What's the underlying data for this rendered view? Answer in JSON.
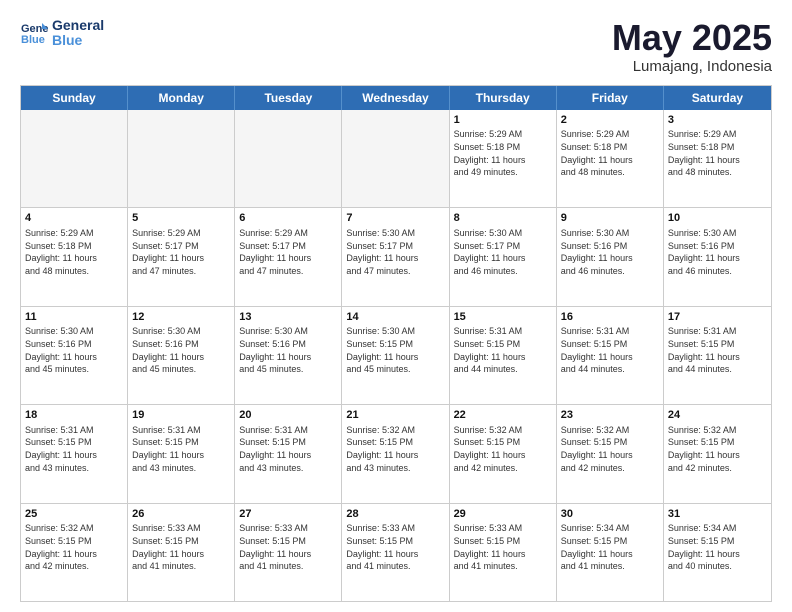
{
  "header": {
    "logo_line1": "General",
    "logo_line2": "Blue",
    "month": "May 2025",
    "location": "Lumajang, Indonesia"
  },
  "days_of_week": [
    "Sunday",
    "Monday",
    "Tuesday",
    "Wednesday",
    "Thursday",
    "Friday",
    "Saturday"
  ],
  "weeks": [
    [
      {
        "day": "",
        "text": "",
        "empty": true
      },
      {
        "day": "",
        "text": "",
        "empty": true
      },
      {
        "day": "",
        "text": "",
        "empty": true
      },
      {
        "day": "",
        "text": "",
        "empty": true
      },
      {
        "day": "1",
        "text": "Sunrise: 5:29 AM\nSunset: 5:18 PM\nDaylight: 11 hours\nand 49 minutes."
      },
      {
        "day": "2",
        "text": "Sunrise: 5:29 AM\nSunset: 5:18 PM\nDaylight: 11 hours\nand 48 minutes."
      },
      {
        "day": "3",
        "text": "Sunrise: 5:29 AM\nSunset: 5:18 PM\nDaylight: 11 hours\nand 48 minutes."
      }
    ],
    [
      {
        "day": "4",
        "text": "Sunrise: 5:29 AM\nSunset: 5:18 PM\nDaylight: 11 hours\nand 48 minutes."
      },
      {
        "day": "5",
        "text": "Sunrise: 5:29 AM\nSunset: 5:17 PM\nDaylight: 11 hours\nand 47 minutes."
      },
      {
        "day": "6",
        "text": "Sunrise: 5:29 AM\nSunset: 5:17 PM\nDaylight: 11 hours\nand 47 minutes."
      },
      {
        "day": "7",
        "text": "Sunrise: 5:30 AM\nSunset: 5:17 PM\nDaylight: 11 hours\nand 47 minutes."
      },
      {
        "day": "8",
        "text": "Sunrise: 5:30 AM\nSunset: 5:17 PM\nDaylight: 11 hours\nand 46 minutes."
      },
      {
        "day": "9",
        "text": "Sunrise: 5:30 AM\nSunset: 5:16 PM\nDaylight: 11 hours\nand 46 minutes."
      },
      {
        "day": "10",
        "text": "Sunrise: 5:30 AM\nSunset: 5:16 PM\nDaylight: 11 hours\nand 46 minutes."
      }
    ],
    [
      {
        "day": "11",
        "text": "Sunrise: 5:30 AM\nSunset: 5:16 PM\nDaylight: 11 hours\nand 45 minutes."
      },
      {
        "day": "12",
        "text": "Sunrise: 5:30 AM\nSunset: 5:16 PM\nDaylight: 11 hours\nand 45 minutes."
      },
      {
        "day": "13",
        "text": "Sunrise: 5:30 AM\nSunset: 5:16 PM\nDaylight: 11 hours\nand 45 minutes."
      },
      {
        "day": "14",
        "text": "Sunrise: 5:30 AM\nSunset: 5:15 PM\nDaylight: 11 hours\nand 45 minutes."
      },
      {
        "day": "15",
        "text": "Sunrise: 5:31 AM\nSunset: 5:15 PM\nDaylight: 11 hours\nand 44 minutes."
      },
      {
        "day": "16",
        "text": "Sunrise: 5:31 AM\nSunset: 5:15 PM\nDaylight: 11 hours\nand 44 minutes."
      },
      {
        "day": "17",
        "text": "Sunrise: 5:31 AM\nSunset: 5:15 PM\nDaylight: 11 hours\nand 44 minutes."
      }
    ],
    [
      {
        "day": "18",
        "text": "Sunrise: 5:31 AM\nSunset: 5:15 PM\nDaylight: 11 hours\nand 43 minutes."
      },
      {
        "day": "19",
        "text": "Sunrise: 5:31 AM\nSunset: 5:15 PM\nDaylight: 11 hours\nand 43 minutes."
      },
      {
        "day": "20",
        "text": "Sunrise: 5:31 AM\nSunset: 5:15 PM\nDaylight: 11 hours\nand 43 minutes."
      },
      {
        "day": "21",
        "text": "Sunrise: 5:32 AM\nSunset: 5:15 PM\nDaylight: 11 hours\nand 43 minutes."
      },
      {
        "day": "22",
        "text": "Sunrise: 5:32 AM\nSunset: 5:15 PM\nDaylight: 11 hours\nand 42 minutes."
      },
      {
        "day": "23",
        "text": "Sunrise: 5:32 AM\nSunset: 5:15 PM\nDaylight: 11 hours\nand 42 minutes."
      },
      {
        "day": "24",
        "text": "Sunrise: 5:32 AM\nSunset: 5:15 PM\nDaylight: 11 hours\nand 42 minutes."
      }
    ],
    [
      {
        "day": "25",
        "text": "Sunrise: 5:32 AM\nSunset: 5:15 PM\nDaylight: 11 hours\nand 42 minutes."
      },
      {
        "day": "26",
        "text": "Sunrise: 5:33 AM\nSunset: 5:15 PM\nDaylight: 11 hours\nand 41 minutes."
      },
      {
        "day": "27",
        "text": "Sunrise: 5:33 AM\nSunset: 5:15 PM\nDaylight: 11 hours\nand 41 minutes."
      },
      {
        "day": "28",
        "text": "Sunrise: 5:33 AM\nSunset: 5:15 PM\nDaylight: 11 hours\nand 41 minutes."
      },
      {
        "day": "29",
        "text": "Sunrise: 5:33 AM\nSunset: 5:15 PM\nDaylight: 11 hours\nand 41 minutes."
      },
      {
        "day": "30",
        "text": "Sunrise: 5:34 AM\nSunset: 5:15 PM\nDaylight: 11 hours\nand 41 minutes."
      },
      {
        "day": "31",
        "text": "Sunrise: 5:34 AM\nSunset: 5:15 PM\nDaylight: 11 hours\nand 40 minutes."
      }
    ]
  ]
}
